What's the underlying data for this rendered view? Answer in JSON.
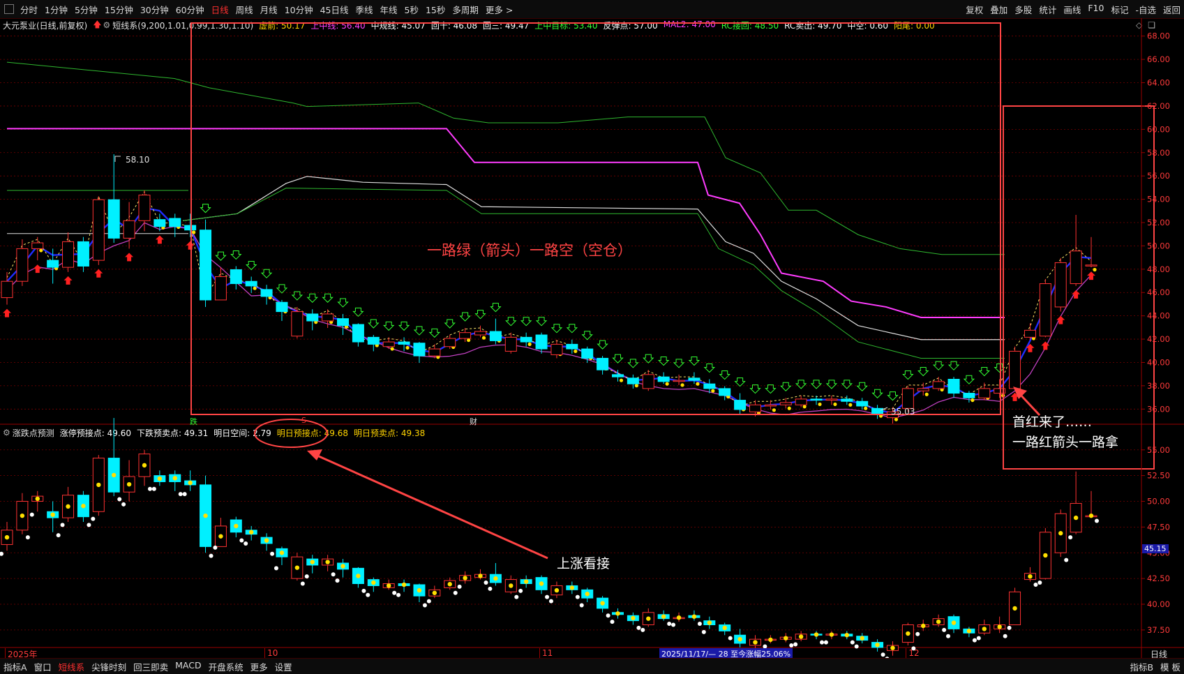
{
  "toolbar": {
    "periods": [
      "分时",
      "1分钟",
      "5分钟",
      "15分钟",
      "30分钟",
      "60分钟",
      "日线",
      "周线",
      "月线",
      "10分钟",
      "45日线",
      "季线",
      "年线",
      "5秒",
      "15秒",
      "多周期",
      "更多 >"
    ],
    "active_period": "日线",
    "right_items": [
      "复权",
      "叠加",
      "多股",
      "统计",
      "画线",
      "F10",
      "标记",
      "-自选",
      "返回"
    ]
  },
  "main_legend": {
    "stock": "大元泵业(日线,前复权)",
    "indicator": "短线系(9,200,1.01,0.99,1.30,1.10)",
    "items": [
      {
        "text": "虚箭: 50.17",
        "color": "#ffd400"
      },
      {
        "text": "上中线: 56.40",
        "color": "#ff40ff"
      },
      {
        "text": "中规线: 45.07",
        "color": "#ffffff"
      },
      {
        "text": "回十: 46.08",
        "color": "#ffffff"
      },
      {
        "text": "回三: 49.47",
        "color": "#ffffff"
      },
      {
        "text": "上中目标: 53.40",
        "color": "#33ff33"
      },
      {
        "text": "反弹点: 57.00",
        "color": "#ffffff"
      },
      {
        "text": "MAL2: 47.00",
        "color": "#ff40ff"
      },
      {
        "text": "RC接回: 48.50",
        "color": "#33ff33"
      },
      {
        "text": "RC卖出: 49.70",
        "color": "#ffffff"
      },
      {
        "text": "中空: 0.60",
        "color": "#ffffff"
      },
      {
        "text": "阳尾: 0.00",
        "color": "#ffd400"
      }
    ]
  },
  "sub_legend": {
    "title": "涨跌点预测",
    "items": [
      {
        "text": "涨停预接点: 49.60",
        "color": "#ffffff"
      },
      {
        "text": "下跌预卖点: 49.31",
        "color": "#ffffff"
      },
      {
        "text": "明日空间: 2.79",
        "color": "#ffffff"
      },
      {
        "text": "明日预接点: 49.68",
        "color": "#ffd400"
      },
      {
        "text": "明日预卖点: 49.38",
        "color": "#ffd400"
      }
    ]
  },
  "main_axis_labels": [
    "68.00",
    "66.00",
    "64.00",
    "62.00",
    "60.00",
    "58.00",
    "56.00",
    "54.00",
    "52.00",
    "50.00",
    "48.00",
    "46.00",
    "44.00",
    "42.00",
    "40.00",
    "38.00",
    "36.00"
  ],
  "sub_axis_labels": [
    "55.00",
    "52.50",
    "50.00",
    "47.50",
    "45.00",
    "42.50",
    "40.00",
    "37.50"
  ],
  "price_tag": "45.15",
  "high_label": "58.10",
  "low_label": "35.03",
  "markers": {
    "die": "跌",
    "s": "S",
    "cai": "财"
  },
  "x_labels": [
    "2025年",
    "10",
    "11",
    "12"
  ],
  "date_range_text": "2025/11/17/— 28 至今涨幅25.06%",
  "period_label": "日线",
  "annotations": {
    "box_text": "一路绿（箭头）一路空（空仓）",
    "first_red_1": "首红来了……",
    "first_red_2": "一路红箭头一路拿",
    "up_watch": "上涨看接"
  },
  "bottom_tabs": [
    "指标A",
    "窗口",
    "短线系",
    "尖锋时刻",
    "回三即卖",
    "MACD",
    "开盘系统",
    "更多",
    "设置"
  ],
  "active_bottom_tab": "短线系",
  "bottom_right": [
    "指标B",
    "模 板"
  ],
  "colors": {
    "up": "#ff3232",
    "down": "#00f0ff",
    "axis": "#9a0000",
    "grid": "#7a0000",
    "annotation": "#ff4444"
  },
  "chart_data": {
    "type": "candlestick",
    "title": "大元泵业(日线,前复权)",
    "ylim_main": [
      35,
      69
    ],
    "ylim_sub": [
      36,
      56
    ],
    "candles": [
      [
        45.8,
        47.2,
        48.0,
        45.2
      ],
      [
        47.2,
        50.0,
        50.8,
        46.8
      ],
      [
        50.0,
        50.5,
        51.0,
        49.0
      ],
      [
        49.0,
        48.4,
        50.0,
        47.0
      ],
      [
        48.4,
        50.6,
        51.4,
        48.0
      ],
      [
        50.6,
        48.5,
        51.0,
        48.0
      ],
      [
        49.0,
        54.2,
        54.5,
        48.6
      ],
      [
        54.2,
        50.9,
        58.1,
        50.5
      ],
      [
        50.9,
        52.4,
        54.0,
        50.0
      ],
      [
        52.4,
        54.6,
        55.0,
        51.5
      ],
      [
        52.5,
        51.9,
        53.0,
        51.5
      ],
      [
        52.6,
        51.9,
        53.0,
        51.0
      ],
      [
        52.0,
        51.6,
        53.0,
        51.0
      ],
      [
        51.6,
        45.6,
        52.5,
        45.0
      ],
      [
        45.6,
        47.6,
        48.4,
        45.8
      ],
      [
        48.2,
        47.0,
        48.5,
        46.5
      ],
      [
        47.2,
        46.8,
        47.6,
        46.2
      ],
      [
        46.5,
        45.9,
        46.9,
        45.2
      ],
      [
        45.4,
        44.6,
        45.6,
        43.8
      ],
      [
        42.5,
        44.6,
        45.0,
        42.3
      ],
      [
        44.4,
        43.8,
        44.8,
        43.0
      ],
      [
        43.8,
        44.4,
        44.8,
        43.2
      ],
      [
        44.0,
        43.4,
        44.4,
        42.6
      ],
      [
        43.5,
        42.0,
        43.6,
        41.6
      ],
      [
        42.4,
        41.8,
        42.6,
        41.2
      ],
      [
        41.6,
        42.0,
        42.4,
        41.4
      ],
      [
        42.0,
        41.8,
        42.4,
        41.2
      ],
      [
        41.9,
        40.8,
        42.0,
        40.2
      ],
      [
        40.8,
        41.4,
        41.8,
        40.6
      ],
      [
        41.6,
        42.3,
        42.6,
        41.4
      ],
      [
        42.3,
        42.8,
        43.2,
        42.0
      ],
      [
        42.6,
        42.9,
        43.4,
        42.4
      ],
      [
        42.9,
        42.1,
        44.0,
        41.8
      ],
      [
        41.2,
        42.4,
        42.8,
        41.0
      ],
      [
        42.4,
        42.0,
        42.8,
        41.6
      ],
      [
        42.6,
        41.4,
        42.8,
        41.0
      ],
      [
        40.9,
        41.8,
        42.2,
        40.6
      ],
      [
        41.8,
        41.4,
        42.2,
        41.0
      ],
      [
        41.4,
        40.6,
        41.6,
        40.2
      ],
      [
        40.6,
        39.6,
        40.8,
        39.2
      ],
      [
        39.2,
        39.0,
        39.6,
        38.6
      ],
      [
        38.9,
        38.4,
        39.2,
        38.0
      ],
      [
        38.0,
        39.2,
        39.6,
        37.8
      ],
      [
        39.0,
        38.6,
        39.4,
        38.4
      ],
      [
        38.7,
        38.7,
        39.2,
        38.3
      ],
      [
        38.9,
        38.7,
        39.4,
        38.4
      ],
      [
        38.4,
        38.0,
        38.8,
        37.6
      ],
      [
        38.0,
        37.4,
        38.2,
        37.0
      ],
      [
        37.0,
        36.2,
        37.6,
        35.8
      ],
      [
        36.0,
        36.6,
        37.0,
        35.6
      ],
      [
        36.5,
        36.6,
        37.0,
        36.2
      ],
      [
        36.6,
        36.8,
        37.2,
        36.3
      ],
      [
        36.6,
        37.1,
        37.4,
        36.4
      ],
      [
        37.1,
        37.0,
        37.4,
        36.6
      ],
      [
        37.0,
        37.1,
        37.4,
        36.6
      ],
      [
        37.1,
        36.9,
        37.4,
        36.6
      ],
      [
        36.9,
        36.5,
        37.2,
        36.2
      ],
      [
        36.3,
        35.8,
        36.6,
        35.4
      ],
      [
        35.5,
        36.0,
        36.4,
        35.0
      ],
      [
        36.3,
        38.0,
        38.2,
        36.0
      ],
      [
        37.8,
        38.0,
        38.5,
        37.4
      ],
      [
        38.0,
        38.6,
        39.0,
        37.8
      ],
      [
        38.8,
        37.6,
        39.0,
        37.2
      ],
      [
        37.6,
        37.2,
        37.8,
        36.8
      ],
      [
        37.2,
        38.0,
        38.5,
        37.0
      ],
      [
        37.6,
        38.0,
        38.8,
        37.2
      ],
      [
        38.0,
        41.2,
        41.6,
        38.0
      ],
      [
        42.4,
        43.0,
        43.6,
        42.2
      ],
      [
        42.5,
        47.0,
        47.4,
        42.4
      ],
      [
        45.0,
        48.8,
        49.2,
        44.6
      ],
      [
        47.0,
        49.8,
        52.9,
        46.8
      ],
      [
        48.6,
        48.6,
        51.0,
        48.4
      ]
    ]
  }
}
